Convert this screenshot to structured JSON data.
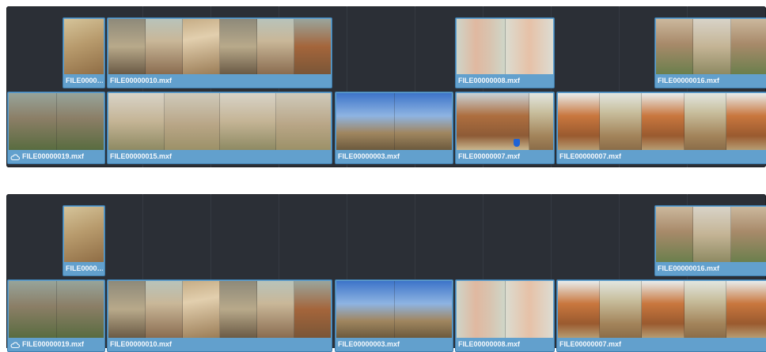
{
  "timelines": [
    {
      "upper_track": [
        {
          "label": "FILE0000…"
        },
        {
          "label": "FILE00000010.mxf"
        },
        {
          "label": "FILE00000008.mxf"
        },
        {
          "label": "FILE00000016.mxf"
        }
      ],
      "lower_track": [
        {
          "label": "FILE00000019.mxf",
          "icon": "cloud-icon"
        },
        {
          "label": "FILE00000015.mxf"
        },
        {
          "label": "FILE00000003.mxf"
        },
        {
          "label": "FILE00000007.mxf"
        },
        {
          "label": "FILE00000007.mxf"
        }
      ]
    },
    {
      "upper_track": [
        {
          "label": "FILE0000…"
        },
        {
          "label": "FILE00000016.mxf"
        }
      ],
      "lower_track": [
        {
          "label": "FILE00000019.mxf",
          "icon": "cloud-icon"
        },
        {
          "label": "FILE00000010.mxf"
        },
        {
          "label": "FILE00000003.mxf"
        },
        {
          "label": "FILE00000008.mxf"
        },
        {
          "label": "FILE00000007.mxf"
        }
      ]
    }
  ],
  "colors": {
    "timeline_background": "#2b2f36",
    "clip_blue": "#62a0cd",
    "marker_blue": "#1f63d6"
  }
}
